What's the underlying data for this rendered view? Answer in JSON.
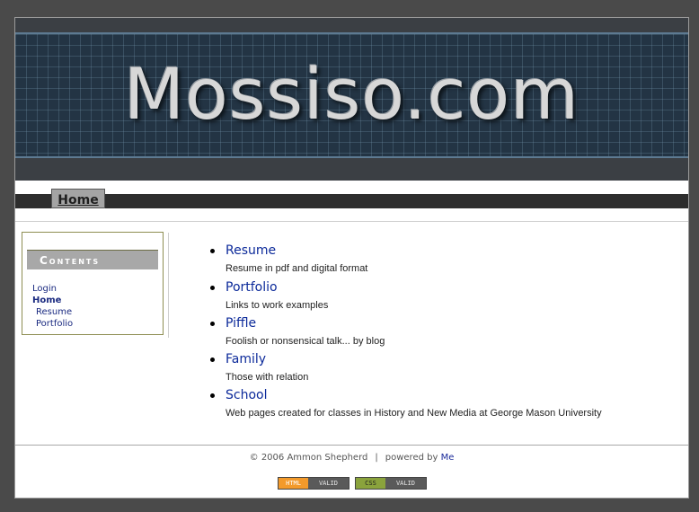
{
  "header": {
    "site_title": "Mossiso.com"
  },
  "nav": {
    "home_label": "Home"
  },
  "sidebar": {
    "heading": "Contents",
    "links": [
      {
        "label": "Login"
      },
      {
        "label": "Home"
      },
      {
        "label": "Resume"
      },
      {
        "label": "Portfolio"
      }
    ]
  },
  "main": {
    "items": [
      {
        "title": "Resume",
        "description": "Resume in pdf and digital format"
      },
      {
        "title": "Portfolio",
        "description": "Links to work examples"
      },
      {
        "title": "Piffle",
        "description": "Foolish or nonsensical talk... by blog"
      },
      {
        "title": "Family",
        "description": "Those with relation"
      },
      {
        "title": "School",
        "description": "Web pages created for classes in History and New Media at George Mason University"
      }
    ]
  },
  "footer": {
    "copyright": "© 2006 Ammon Shepherd",
    "separator": "|",
    "powered_by": "powered by",
    "powered_link": "Me",
    "badges": [
      {
        "left": "HTML",
        "right": "VALID",
        "color": "#f39a2b"
      },
      {
        "left": "CSS",
        "right": "VALID",
        "color": "#8aa33c"
      }
    ]
  },
  "colors": {
    "background": "#4a4a4a",
    "link": "#0c2a9a",
    "banner": "#233444"
  }
}
